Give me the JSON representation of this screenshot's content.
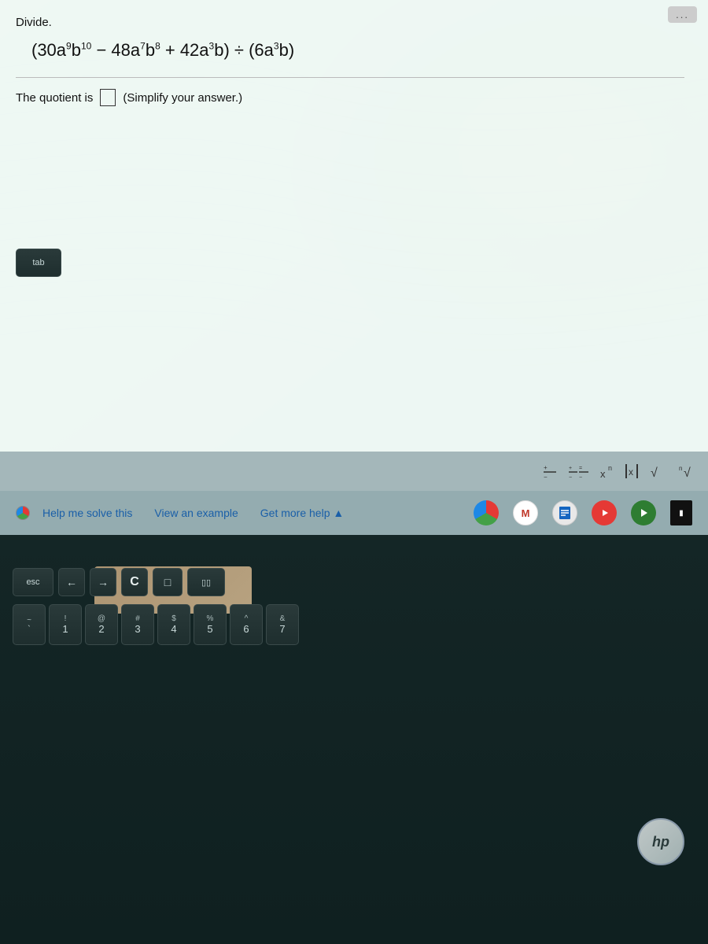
{
  "screen": {
    "problem_label": "Divide.",
    "math_expression_html": "(30a<sup>9</sup>b<sup>10</sup> &minus; 48a<sup>7</sup>b<sup>8</sup> + 42a<sup>3</sup>b) &divide; (6a<sup>3</sup>b)",
    "quotient_prefix": "The quotient is",
    "quotient_suffix": "(Simplify your answer.)",
    "more_options_label": "...",
    "links": {
      "help_label": "Help me solve this",
      "example_label": "View an example",
      "more_help_label": "Get more help ▲"
    }
  },
  "math_toolbar": {
    "icons": [
      {
        "name": "fraction-icon",
        "symbol": "⁺⁄₋"
      },
      {
        "name": "mixed-fraction-icon",
        "symbol": "⁺₌⁄₋"
      },
      {
        "name": "exponent-icon",
        "symbol": "xⁿ"
      },
      {
        "name": "absolute-value-icon",
        "symbol": "|x|"
      },
      {
        "name": "sqrt-icon",
        "symbol": "√"
      },
      {
        "name": "nth-root-icon",
        "symbol": "ⁿ√"
      }
    ]
  },
  "taskbar": {
    "icons": [
      {
        "name": "chrome-icon",
        "label": "Chrome"
      },
      {
        "name": "gmail-icon",
        "label": "M"
      },
      {
        "name": "docs-icon",
        "label": "≡"
      },
      {
        "name": "youtube-icon",
        "label": "▶"
      },
      {
        "name": "play-icon",
        "label": "▶"
      },
      {
        "name": "app-icon",
        "label": ""
      }
    ]
  },
  "keyboard": {
    "row1": [
      {
        "key": "esc",
        "label": "esc"
      },
      {
        "key": "back",
        "label": "←"
      },
      {
        "key": "forward",
        "label": "→"
      },
      {
        "key": "refresh",
        "label": "C"
      },
      {
        "key": "window",
        "label": "□"
      },
      {
        "key": "multiwindow",
        "label": "▯▯"
      }
    ],
    "row2": [
      {
        "top": "~",
        "bottom": "`"
      },
      {
        "top": "!",
        "bottom": "1"
      },
      {
        "top": "@",
        "bottom": "2"
      },
      {
        "top": "#",
        "bottom": "3"
      },
      {
        "top": "$",
        "bottom": "4"
      },
      {
        "top": "%",
        "bottom": "5"
      },
      {
        "top": "^",
        "bottom": "6"
      },
      {
        "top": "&",
        "bottom": "7"
      }
    ]
  },
  "hp_logo": "hp",
  "chrome_circle_visible": true
}
